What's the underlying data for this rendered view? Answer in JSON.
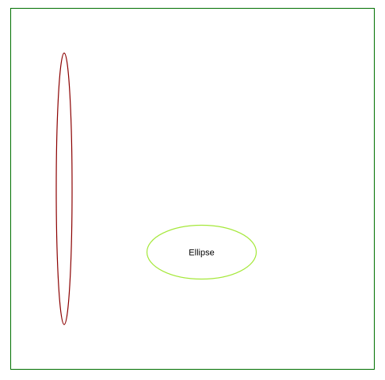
{
  "canvas": {
    "background": "#ffffff",
    "border_color": "#007000"
  },
  "shapes": [
    {
      "kind": "ellipse",
      "stroke": "#8b0000",
      "label": ""
    },
    {
      "kind": "ellipse",
      "stroke": "#a5e83a",
      "label": "Ellipse"
    }
  ]
}
